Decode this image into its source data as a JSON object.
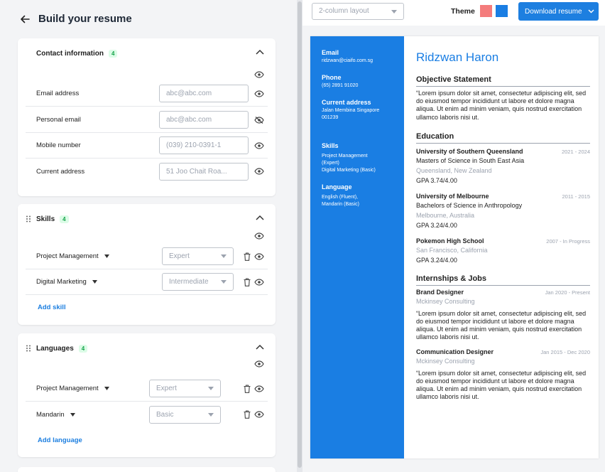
{
  "editor": {
    "title": "Build your resume",
    "contact": {
      "title": "Contact information",
      "count": "4",
      "fields": [
        {
          "label": "Email address",
          "placeholder": "abc@abc.com"
        },
        {
          "label": "Personal email",
          "placeholder": "abc@abc.com"
        },
        {
          "label": "Mobile number",
          "placeholder": "(039) 210-0391-1"
        },
        {
          "label": "Current address",
          "placeholder": "51 Joo Chait Roa..."
        }
      ]
    },
    "skills": {
      "title": "Skills",
      "count": "4",
      "items": [
        {
          "name": "Project Management",
          "level": "Expert"
        },
        {
          "name": "Digital Marketing",
          "level": "Intermediate"
        }
      ],
      "add_label": "Add skill"
    },
    "languages": {
      "title": "Languages",
      "count": "4",
      "items": [
        {
          "name": "Project Management",
          "level": "Expert"
        },
        {
          "name": "Mandarin",
          "level": "Basic"
        }
      ],
      "add_label": "Add language"
    }
  },
  "preview": {
    "layout": "2-column layout",
    "theme_label": "Theme",
    "theme_colors": [
      "#f47c7c",
      "#1a7ee3"
    ],
    "download_label": "Download resume",
    "resume": {
      "name": "Ridzwan Haron",
      "sidebar": {
        "email_label": "Email",
        "email": "ridzwan@ciaifo.com.sg",
        "phone_label": "Phone",
        "phone": "(65) 2891 91020",
        "address_label": "Current address",
        "address_1": "Jalan Membina Singapore",
        "address_2": "001239",
        "skills_label": "Skills",
        "skills_1": "Project Management",
        "skills_2": "(Expert)",
        "skills_3": "Digital Marketing (Basic)",
        "language_label": "Language",
        "language_1": "English (Fluent),",
        "language_2": "Mandarin (Basic)"
      },
      "objective": {
        "title": "Objective Statement",
        "text": "“Lorem ipsum dolor sit amet, consectetur adipiscing elit, sed do eiusmod tempor incididunt ut labore et dolore magna aliqua. Ut enim ad minim veniam, quis nostrud exercitation ullamco laboris nisi ut."
      },
      "education": {
        "title": "Education",
        "items": [
          {
            "school": "University of Southern Queensland",
            "dates": "2021 - 2024",
            "degree": "Masters of Science in South East Asia",
            "place": "Queensland, New Zealand",
            "gpa": "GPA 3.74/4.00"
          },
          {
            "school": "University of Melbourne",
            "dates": "2011 - 2015",
            "degree": "Bachelors of Science in Anthropology",
            "place": "Melbourne, Australia",
            "gpa": "GPA 3.24/4.00"
          },
          {
            "school": "Pokemon High School",
            "dates": "2007 - In Progress",
            "place": "San Francisco, California",
            "gpa": "GPA 3.24/4.00"
          }
        ]
      },
      "internships": {
        "title": "Internships & Jobs",
        "items": [
          {
            "role": "Brand Designer",
            "dates": "Jan 2020 - Present",
            "company": "Mckinsey Consulting",
            "text": "“Lorem ipsum dolor sit amet, consectetur adipiscing elit, sed do eiusmod tempor incididunt ut labore et dolore magna aliqua. Ut enim ad minim veniam, quis nostrud exercitation ullamco laboris nisi ut."
          },
          {
            "role": "Communication Designer",
            "dates": "Jan 2015 - Dec 2020",
            "company": "Mckinsey Consulting",
            "text": "“Lorem ipsum dolor sit amet, consectetur adipiscing elit, sed do eiusmod tempor incididunt ut labore et dolore magna aliqua. Ut enim ad minim veniam, quis nostrud exercitation ullamco laboris nisi ut."
          }
        ]
      }
    }
  }
}
